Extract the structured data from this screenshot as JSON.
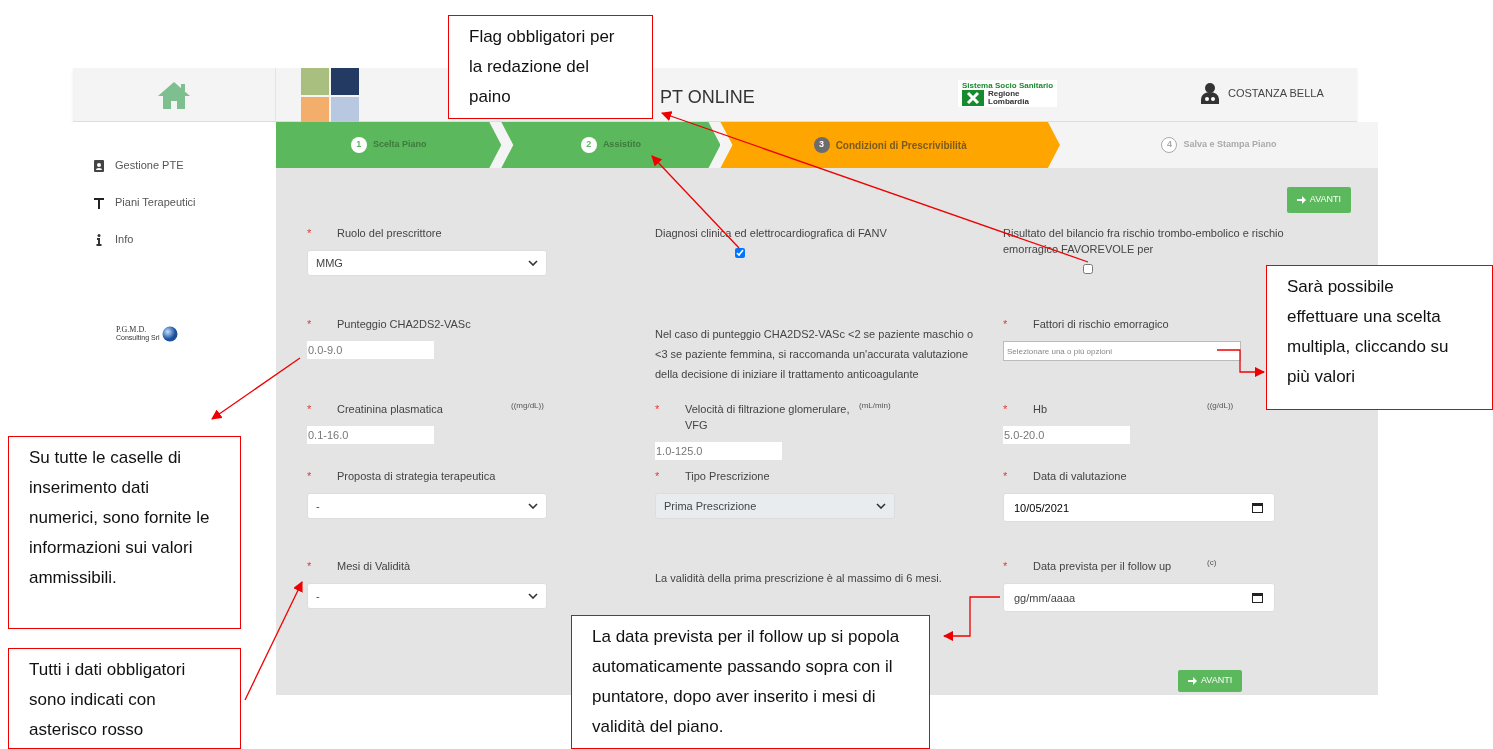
{
  "header": {
    "app_title": "PT ONLINE",
    "region_logo": {
      "caption": "Sistema Socio Sanitario",
      "name_line1": "Regione",
      "name_line2": "Lombardia"
    },
    "user": "COSTANZA BELLA"
  },
  "sidebar": {
    "items": [
      {
        "label": "Gestione PTE",
        "kind": "contacts"
      },
      {
        "label": "Piani Terapeutici",
        "kind": "caduceus"
      },
      {
        "label": "Info",
        "kind": "info"
      }
    ],
    "footer_logo": {
      "name": "P.G.M.D.",
      "sub": "Consulting Srl"
    }
  },
  "steps": [
    {
      "number": "1",
      "label": "Scelta Piano",
      "completed": true,
      "selected": false
    },
    {
      "number": "2",
      "label": "Assistito",
      "completed": true,
      "selected": false
    },
    {
      "number": "3",
      "label": "Condizioni di Prescrivibilità",
      "completed": false,
      "selected": true
    },
    {
      "number": "4",
      "label": "Salva e Stampa Piano",
      "completed": false,
      "selected": false
    }
  ],
  "next_button_top": "AVANTI",
  "form_rows": [
    [
      {
        "kind": "select",
        "label": "Ruolo del prescrittore",
        "required_mark": "*",
        "value": "MMG",
        "disabled": false
      },
      {
        "kind": "checkbox",
        "label": "Diagnosi clinica ed elettrocardiografica di FANV",
        "checked": true
      },
      {
        "kind": "checkbox",
        "label": "Risultato del bilancio fra rischio trombo-embolico e rischio emorragico FAVOREVOLE per",
        "checked": false
      }
    ],
    [
      {
        "kind": "number",
        "label": "Punteggio CHA2DS2-VASc",
        "required_mark": "*",
        "placeholder": "0.0-9.0"
      },
      {
        "kind": "note",
        "text": "Nel caso di punteggio CHA2DS2-VASc <2 se paziente maschio o <3 se paziente femmina, si raccomanda un'accurata valutazione della decisione di iniziare il trattamento anticoagulante"
      },
      {
        "kind": "multiselect",
        "label": "Fattori di rischio emorragico",
        "required_mark": "*",
        "placeholder": "Selezionare una o più opzioni"
      }
    ],
    [
      {
        "kind": "number",
        "label": "Creatinina plasmatica",
        "required_mark": "*",
        "unit": "((mg/dL))",
        "placeholder": "0.1-16.0"
      },
      {
        "kind": "number",
        "label": "Velocità di filtrazione glomerulare, VFG",
        "required_mark": "*",
        "unit": "(mL/min)",
        "placeholder": "1.0-125.0"
      },
      {
        "kind": "number",
        "label": "Hb",
        "required_mark": "*",
        "unit": "((g/dL))",
        "placeholder": "5.0-20.0"
      }
    ],
    [
      {
        "kind": "select",
        "label": "Proposta di strategia terapeutica",
        "required_mark": "*",
        "value": "-",
        "disabled": false
      },
      {
        "kind": "select",
        "label": "Tipo Prescrizione",
        "required_mark": "*",
        "value": "Prima Prescrizione",
        "disabled": true
      },
      {
        "kind": "date",
        "label": "Data di valutazione",
        "required_mark": "*",
        "value": "10/05/2021"
      }
    ],
    [
      {
        "kind": "select",
        "label": "Mesi di Validità",
        "required_mark": "*",
        "value": "-",
        "disabled": false
      },
      {
        "kind": "note",
        "text": "La validità della prima prescrizione è al massimo di 6 mesi."
      },
      {
        "kind": "date",
        "label": "Data prevista per il follow up",
        "required_mark": "*",
        "unit": "(c)",
        "placeholder": "gg/mm/aaaa"
      }
    ]
  ],
  "next_button_bottom": "AVANTI",
  "callouts": [
    {
      "text": "Flag obbligatori per la redazione del paino"
    },
    {
      "text": "Sarà possibile effettuare una scelta multipla, cliccando su più valori"
    },
    {
      "text": "Su tutte le caselle di inserimento dati numerici, sono fornite le informazioni sui valori ammissibili."
    },
    {
      "text": "Tutti i dati obbligatori sono indicati con asterisco rosso"
    },
    {
      "text": "La data prevista per il follow up si popola automaticamente passando sopra con il puntatore, dopo aver inserito i mesi di validità del piano."
    }
  ]
}
